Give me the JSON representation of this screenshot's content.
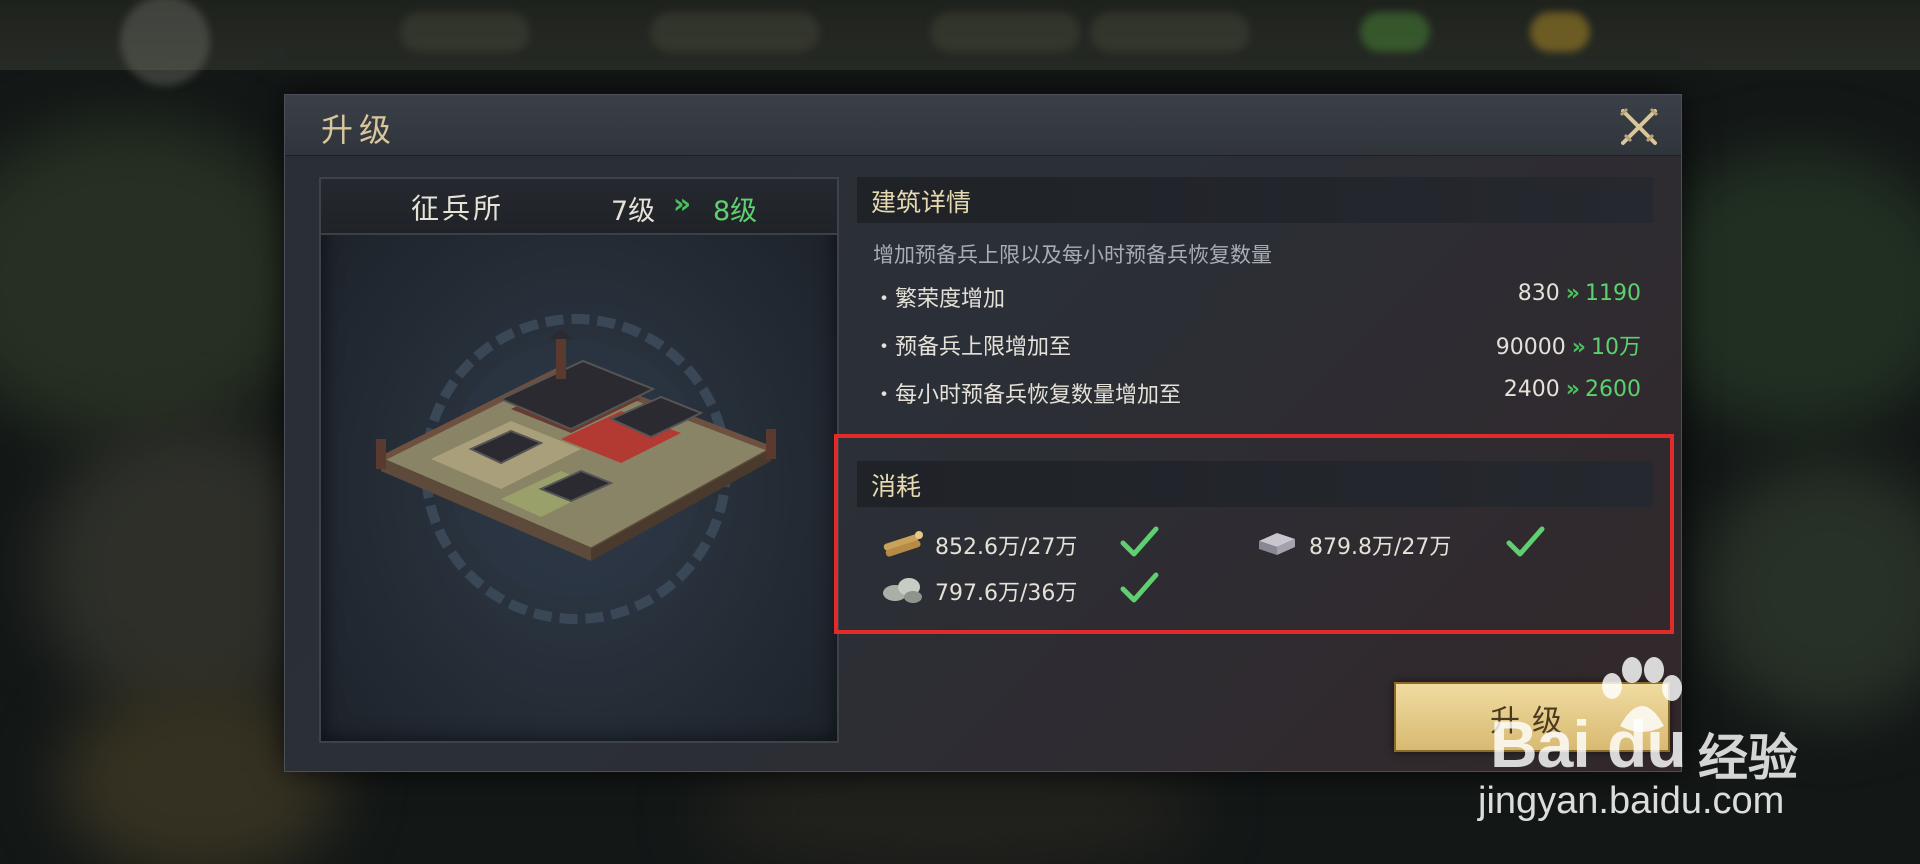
{
  "dialog": {
    "title": "升级"
  },
  "building": {
    "name": "征兵所",
    "level_from": "7级",
    "level_arrow": "»",
    "level_to": "8级"
  },
  "details": {
    "header": "建筑详情",
    "description": "增加预备兵上限以及每小时预备兵恢复数量",
    "stats": [
      {
        "label": "・繁荣度增加",
        "from": "830",
        "arrow": "»",
        "to": "1190"
      },
      {
        "label": "・预备兵上限增加至",
        "from": "90000",
        "arrow": "»",
        "to": "10万"
      },
      {
        "label": "・每小时预备兵恢复数量增加至",
        "from": "2400",
        "arrow": "»",
        "to": "2600"
      }
    ]
  },
  "cost": {
    "header": "消耗",
    "items": [
      {
        "icon": "wood-icon",
        "amount": "852.6万/27万",
        "met": true
      },
      {
        "icon": "iron-icon",
        "amount": "879.8万/27万",
        "met": true
      },
      {
        "icon": "stone-icon",
        "amount": "797.6万/36万",
        "met": true
      }
    ]
  },
  "upgrade_button": {
    "label": "升级"
  },
  "watermark": {
    "brand": "Bai du",
    "brand_cn": "经验",
    "url": "jingyan.baidu.com"
  },
  "colors": {
    "accent_green": "#5fd06f",
    "highlight_red": "#e12a2a",
    "title_gold": "#d9c79b",
    "button_gold": "#e6cc8a"
  }
}
